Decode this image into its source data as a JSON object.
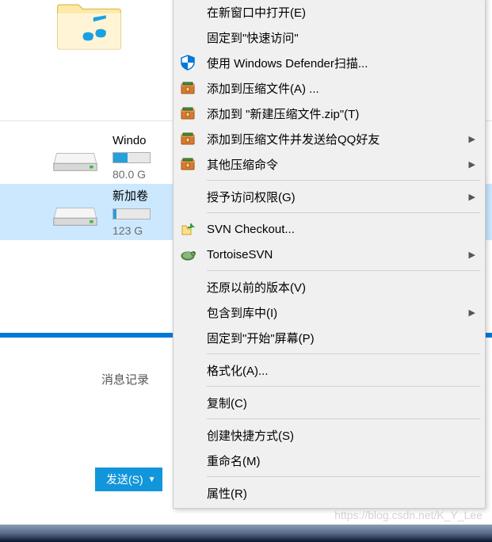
{
  "drives": [
    {
      "label": "Windo",
      "size": "80.0 G",
      "selected": false
    },
    {
      "label": "新加卷",
      "size": "123 G",
      "selected": true
    }
  ],
  "historyLabel": "消息记录",
  "sendButton": {
    "label": "发送(S)"
  },
  "watermark": "https://blog.csdn.net/K_Y_Lee",
  "menu": {
    "items": [
      {
        "label": "在新窗口中打开(E)",
        "icon": "none"
      },
      {
        "label": "固定到\"快速访问\"",
        "icon": "none"
      },
      {
        "label": "使用 Windows Defender扫描...",
        "icon": "defender"
      },
      {
        "label": "添加到压缩文件(A) ...",
        "icon": "archive"
      },
      {
        "label": "添加到 \"新建压缩文件.zip\"(T)",
        "icon": "archive"
      },
      {
        "label": "添加到压缩文件并发送给QQ好友",
        "icon": "archive",
        "submenu": true
      },
      {
        "label": "其他压缩命令",
        "icon": "archive",
        "submenu": true
      },
      {
        "sep": true
      },
      {
        "label": "授予访问权限(G)",
        "icon": "none",
        "submenu": true
      },
      {
        "sep": true
      },
      {
        "label": "SVN Checkout...",
        "icon": "svn-checkout"
      },
      {
        "label": "TortoiseSVN",
        "icon": "tortoise",
        "submenu": true
      },
      {
        "sep": true
      },
      {
        "label": "还原以前的版本(V)",
        "icon": "none"
      },
      {
        "label": "包含到库中(I)",
        "icon": "none",
        "submenu": true
      },
      {
        "label": "固定到\"开始\"屏幕(P)",
        "icon": "none"
      },
      {
        "sep": true
      },
      {
        "label": "格式化(A)...",
        "icon": "none"
      },
      {
        "sep": true
      },
      {
        "label": "复制(C)",
        "icon": "none"
      },
      {
        "sep": true
      },
      {
        "label": "创建快捷方式(S)",
        "icon": "none"
      },
      {
        "label": "重命名(M)",
        "icon": "none"
      },
      {
        "sep": true
      },
      {
        "label": "属性(R)",
        "icon": "none"
      }
    ]
  }
}
